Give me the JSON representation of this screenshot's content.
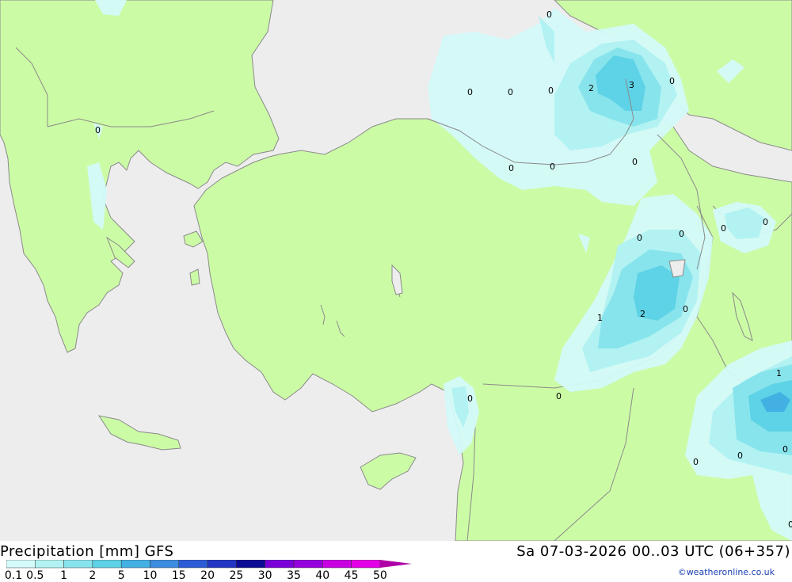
{
  "header": {
    "left_title": "Precipitation [mm] GFS",
    "right_title": "Sa 07-03-2026 00..03 UTC (06+357)",
    "credit": "©weatheronline.co.uk"
  },
  "map": {
    "sea_color": "#ededed",
    "land_color": "#ccfba6",
    "border_color": "#8a8a8a",
    "contour_labels": [
      "0",
      "0",
      "0",
      "0",
      "0",
      "0",
      "2",
      "3",
      "0",
      "0",
      "0",
      "0",
      "0",
      "0",
      "0",
      "0",
      "1",
      "2",
      "0",
      "0",
      "0",
      "1",
      "0",
      "0",
      "0",
      "0"
    ]
  },
  "legend": {
    "levels": [
      "0.1",
      "0.5",
      "1",
      "2",
      "5",
      "10",
      "15",
      "20",
      "25",
      "30",
      "35",
      "40",
      "45",
      "50"
    ],
    "colors": [
      "#d4fafa",
      "#b2f2f2",
      "#88e4ec",
      "#5ed2e6",
      "#42b0e2",
      "#3c8ce0",
      "#2c5cd6",
      "#2236c4",
      "#0c0c96",
      "#7a00d8",
      "#9600dc",
      "#c800e2",
      "#e400e6",
      "#b000a8"
    ]
  }
}
